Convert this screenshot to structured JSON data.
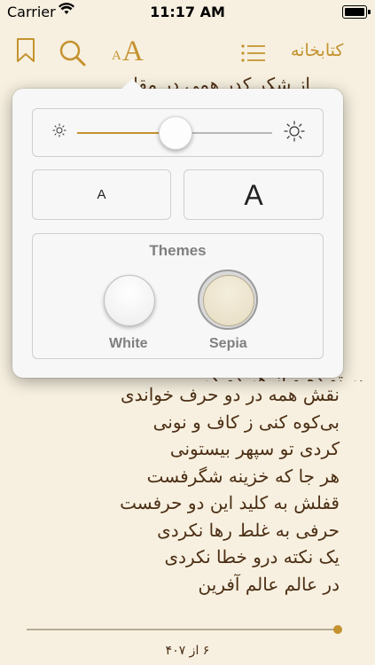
{
  "status_bar": {
    "carrier": "Carrier",
    "time": "11:17 AM"
  },
  "toolbar": {
    "font_small_glyph": "A",
    "font_large_glyph": "A",
    "library_label": "کتابخانه"
  },
  "book_text": {
    "top_peek": "از شکر کدر همی در مقا",
    "lines": [
      "نقش همه در دو حرف خواندی",
      "بی‌کوه کنی ز کاف و نونی",
      "کردی تو سپهر بیستونی",
      "هر جا که خزینه شگرفست",
      "قفلش به کلید این دو حرفست",
      "حرفی به غلط رها نکردی",
      "یک نکته درو خطا نکردی",
      "در عالم عالم آفرین"
    ],
    "bottom_peek": "بر تو ده و از هر دو ک"
  },
  "reading_progress": {
    "fraction": 1.0,
    "page_indicator": "۶ از ۴۰۷"
  },
  "settings_popover": {
    "brightness": {
      "value": 0.5
    },
    "font_buttons": {
      "smaller_label": "A",
      "larger_label": "A"
    },
    "themes": {
      "title": "Themes",
      "options": [
        {
          "label": "White",
          "selected": false
        },
        {
          "label": "Sepia",
          "selected": true
        }
      ]
    }
  },
  "colors": {
    "accent": "#c4922f",
    "page_background": "#f7f0e0",
    "text": "#4b2e14"
  }
}
